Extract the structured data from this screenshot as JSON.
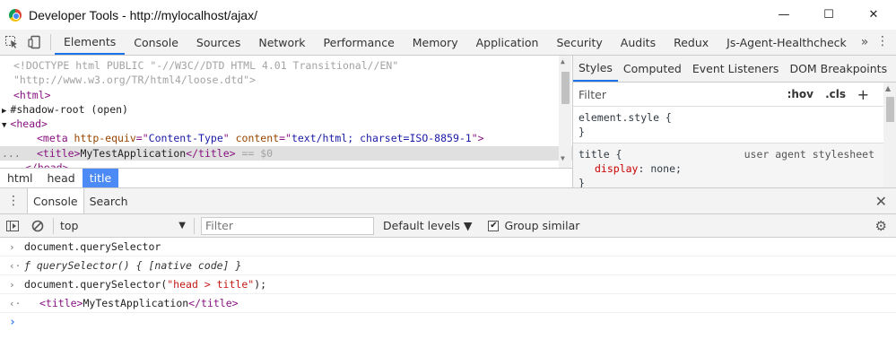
{
  "window": {
    "title": "Developer Tools - http://mylocalhost/ajax/",
    "minimize": "—",
    "maximize": "☐",
    "close": "✕"
  },
  "toolbar": {
    "tabs": [
      "Elements",
      "Console",
      "Sources",
      "Network",
      "Performance",
      "Memory",
      "Application",
      "Security",
      "Audits",
      "Redux",
      "Js-Agent-Healthcheck"
    ],
    "active_tab": "Elements",
    "more": "»",
    "menu": "⋮"
  },
  "elements": {
    "lines": [
      {
        "indent": 0,
        "parts": [
          {
            "t": "<!DOCTYPE html PUBLIC \"-//W3C//DTD HTML 4.01 Transitional//EN\"",
            "c": "c-gray"
          }
        ]
      },
      {
        "indent": 0,
        "parts": [
          {
            "t": "\"http://www.w3.org/TR/html4/loose.dtd\">",
            "c": "c-gray"
          }
        ]
      },
      {
        "indent": 0,
        "parts": [
          {
            "t": "<html>",
            "c": "c-tag"
          }
        ]
      },
      {
        "indent": 0,
        "parts": [
          {
            "t": "▶",
            "c": "c-text"
          },
          {
            "t": "#shadow-root (open)",
            "c": "c-text"
          }
        ]
      },
      {
        "indent": 0,
        "parts": [
          {
            "t": "▼",
            "c": "c-text"
          },
          {
            "t": "<head>",
            "c": "c-tag"
          }
        ]
      },
      {
        "indent": 2,
        "parts": [
          {
            "t": "<meta ",
            "c": "c-tag"
          },
          {
            "t": "http-equiv",
            "c": "c-attr"
          },
          {
            "t": "=\"",
            "c": "c-tag"
          },
          {
            "t": "Content-Type",
            "c": "c-val"
          },
          {
            "t": "\" ",
            "c": "c-tag"
          },
          {
            "t": "content",
            "c": "c-attr"
          },
          {
            "t": "=\"",
            "c": "c-tag"
          },
          {
            "t": "text/html; charset=ISO-8859-1",
            "c": "c-val"
          },
          {
            "t": "\">",
            "c": "c-tag"
          }
        ]
      },
      {
        "indent": 2,
        "selected": true,
        "parts": [
          {
            "t": "<title>",
            "c": "c-tag"
          },
          {
            "t": "MyTestApplication",
            "c": "c-text"
          },
          {
            "t": "</title>",
            "c": "c-tag"
          },
          {
            "t": " == $0",
            "c": "c-gray"
          }
        ]
      },
      {
        "indent": 1,
        "parts": [
          {
            "t": "</head>",
            "c": "c-tag"
          }
        ]
      }
    ],
    "ellipsis": "..."
  },
  "breadcrumbs": [
    "html",
    "head",
    "title"
  ],
  "styles": {
    "tabs": [
      "Styles",
      "Computed",
      "Event Listeners",
      "DOM Breakpoints"
    ],
    "more": "»",
    "filter_placeholder": "Filter",
    "hov": ":hov",
    "cls": ".cls",
    "add": "+",
    "element_style_selector": "element.style {",
    "close_brace": "}",
    "rule_selector": "title {",
    "rule_source": "user agent stylesheet",
    "prop_name": "display",
    "prop_value": "none;"
  },
  "drawer": {
    "tabs": [
      "Console",
      "Search"
    ],
    "active_tab": "Console",
    "close": "✕",
    "handle": "⋮"
  },
  "console_toolbar": {
    "context": "top",
    "filter_placeholder": "Filter",
    "levels": "Default levels ▼",
    "group_similar": "Group similar",
    "group_checked": true
  },
  "console": {
    "entries": [
      {
        "kind": "input",
        "prefix": "›",
        "parts": [
          {
            "t": "document.querySelector",
            "c": "c-text"
          }
        ]
      },
      {
        "kind": "output",
        "prefix": "‹·",
        "parts": [
          {
            "t": "ƒ querySelector() { [native code] }",
            "c": "c-italic"
          }
        ]
      },
      {
        "kind": "input",
        "prefix": "›",
        "parts": [
          {
            "t": "document.querySelector(",
            "c": "c-text"
          },
          {
            "t": "\"head > title\"",
            "c": "c-str"
          },
          {
            "t": ");",
            "c": "c-text"
          }
        ]
      },
      {
        "kind": "output",
        "prefix": "‹·",
        "indent": true,
        "parts": [
          {
            "t": "<title>",
            "c": "c-tag"
          },
          {
            "t": "MyTestApplication",
            "c": "c-text"
          },
          {
            "t": "</title>",
            "c": "c-tag"
          }
        ]
      },
      {
        "kind": "prompt",
        "prefix": "›",
        "parts": []
      }
    ]
  }
}
